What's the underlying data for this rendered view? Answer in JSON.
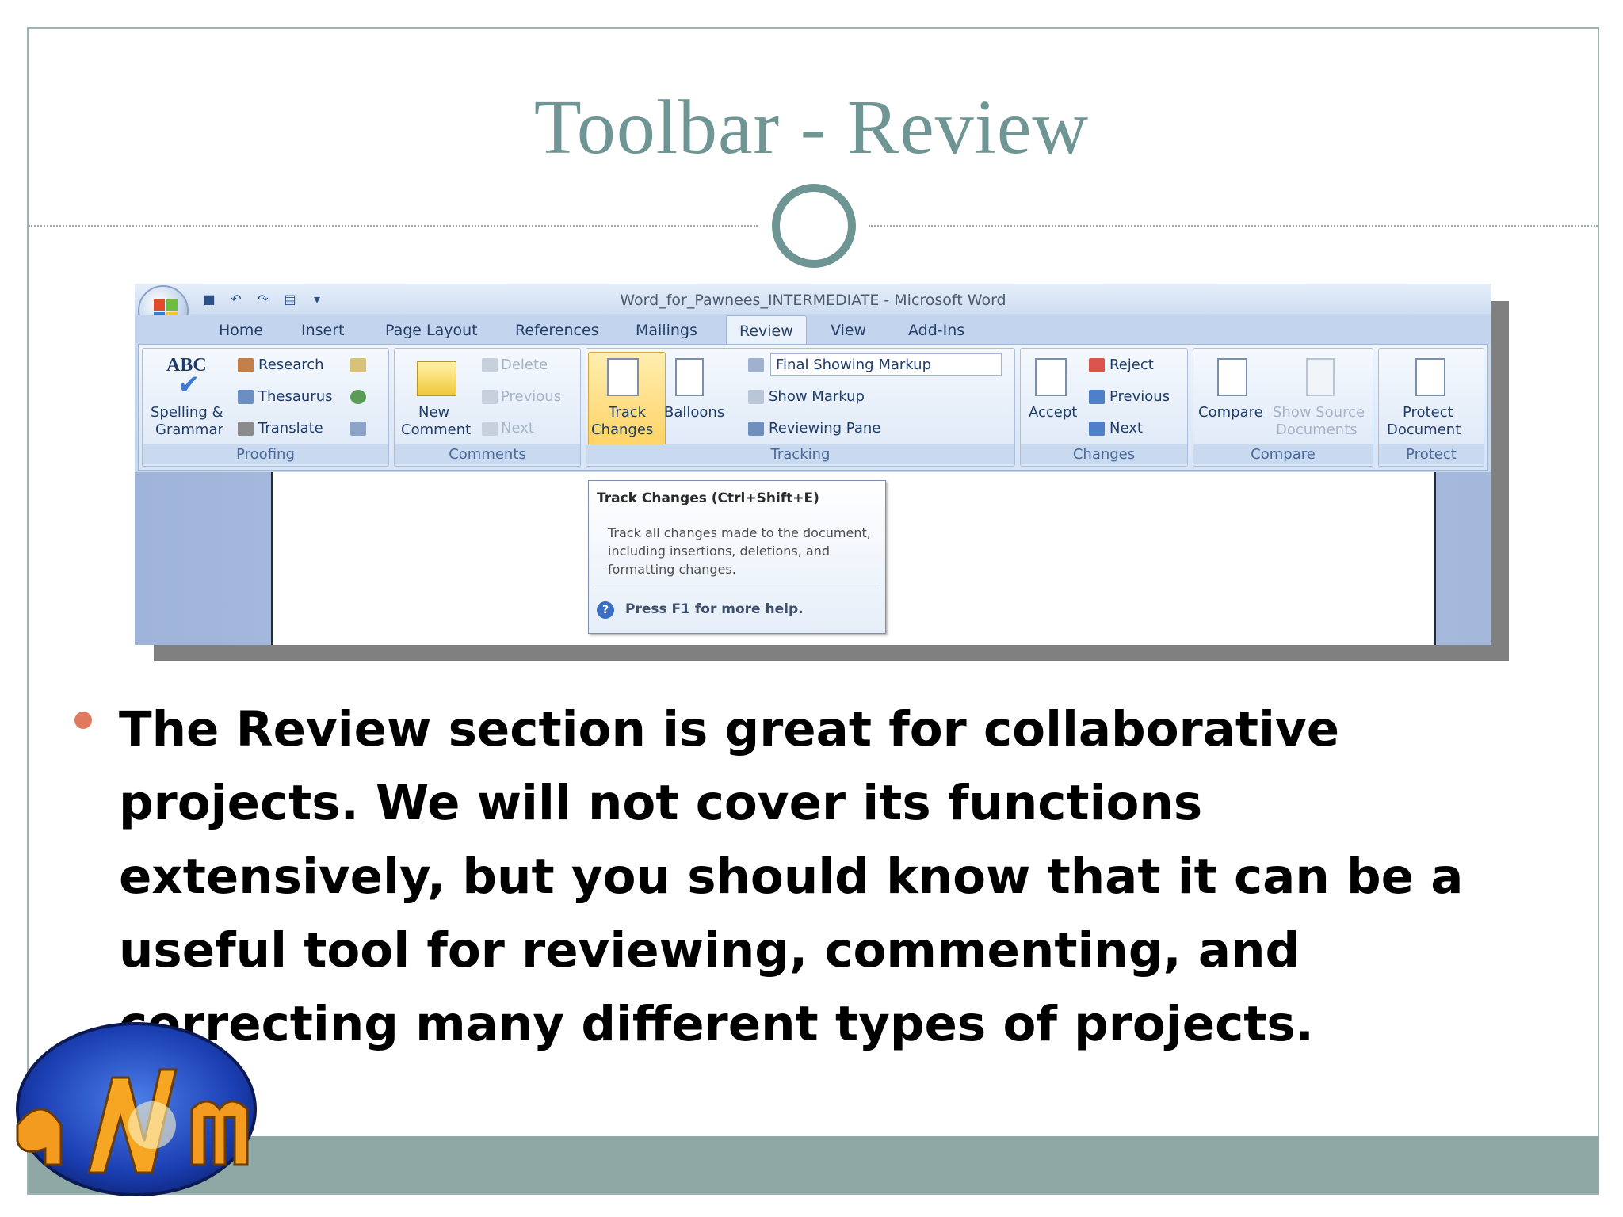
{
  "slide": {
    "title": "Toolbar - Review",
    "bullet_text": "The Review section is great for collaborative projects. We will not cover its functions extensively, but you should know that it can be a useful tool for reviewing, commenting, and correcting many different types of projects."
  },
  "word": {
    "window_title": "Word_for_Pawnees_INTERMEDIATE - Microsoft Word",
    "tabs": [
      "Home",
      "Insert",
      "Page Layout",
      "References",
      "Mailings",
      "Review",
      "View",
      "Add-Ins"
    ],
    "active_tab": "Review",
    "groups": {
      "proofing": {
        "label": "Proofing",
        "spelling_1": "Spelling &",
        "spelling_2": "Grammar",
        "abc": "ABC",
        "research": "Research",
        "thesaurus": "Thesaurus",
        "translate": "Translate"
      },
      "comments": {
        "label": "Comments",
        "new_1": "New",
        "new_2": "Comment",
        "delete": "Delete",
        "previous": "Previous",
        "next": "Next"
      },
      "tracking": {
        "label": "Tracking",
        "track_1": "Track",
        "track_2": "Changes",
        "balloons": "Balloons",
        "markup_select": "Final Showing Markup",
        "show_markup": "Show Markup",
        "reviewing_pane": "Reviewing Pane"
      },
      "changes": {
        "label": "Changes",
        "accept": "Accept",
        "reject": "Reject",
        "previous": "Previous",
        "next": "Next"
      },
      "compare": {
        "label": "Compare",
        "compare": "Compare",
        "show_source_1": "Show Source",
        "show_source_2": "Documents"
      },
      "protect": {
        "label": "Protect",
        "protect_1": "Protect",
        "protect_2": "Document"
      }
    },
    "tooltip": {
      "title": "Track Changes (Ctrl+Shift+E)",
      "body": "Track all changes made to the document, including insertions, deletions, and formatting changes.",
      "help": "Press F1 for more help."
    }
  },
  "colors": {
    "title": "#6f9694",
    "footer": "#8ea8a6",
    "bullet": "#e07a5f"
  }
}
